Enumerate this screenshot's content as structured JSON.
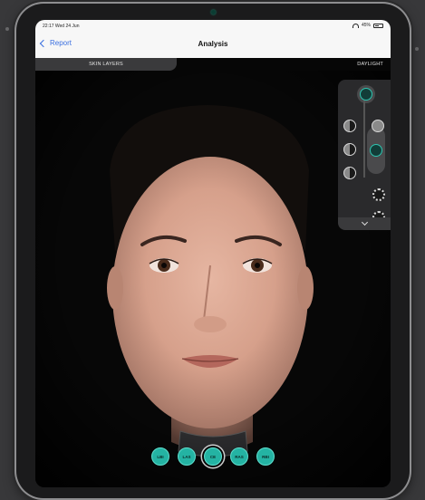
{
  "status_bar": {
    "time": "22:17  Wed 24 Jun",
    "battery": "45%"
  },
  "nav": {
    "back_label": "Report",
    "title": "Analysis"
  },
  "header": {
    "skin_layers_label": "SKIN LAYERS",
    "lighting_label": "DAYLIGHT"
  },
  "mode_buttons": [
    {
      "label": "LBI",
      "active": false
    },
    {
      "label": "LAS",
      "active": false
    },
    {
      "label": "CE",
      "active": true
    },
    {
      "label": "RAS",
      "active": false
    },
    {
      "label": "RBI",
      "active": false
    }
  ],
  "colors": {
    "accent": "#24b3a3",
    "link": "#3a6fe0"
  }
}
